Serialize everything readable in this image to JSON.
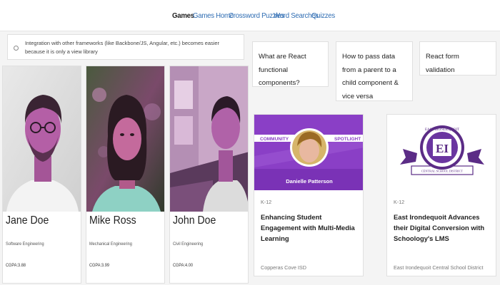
{
  "nav": {
    "items": [
      {
        "label": "Games",
        "active": true
      },
      {
        "label": "Games Home",
        "active": false
      },
      {
        "label": "Crossword Puzzles",
        "active": false
      },
      {
        "label": "Word Searches",
        "active": false
      },
      {
        "label": "Quizzes",
        "active": false
      }
    ]
  },
  "quiz_option": {
    "text": "Integration with other frameworks (like Backbone/JS, Angular, etc.) becomes easier because it is only a view library"
  },
  "question_cards": [
    {
      "text": "What are React functional components?"
    },
    {
      "text": "How to pass data from a parent to a child component & vice versa"
    },
    {
      "text": "React form validation"
    }
  ],
  "profiles": [
    {
      "name": "Jane Doe",
      "department": "Software Engineering",
      "gpa": "CGPA:3.88"
    },
    {
      "name": "Mike Ross",
      "department": "Mechanical Engineering",
      "gpa": "CGPA:3.99"
    },
    {
      "name": "John Doe",
      "department": "Civil Engineering",
      "gpa": "CGPA:4.00"
    }
  ],
  "articles": [
    {
      "banner_left": "COMMUNITY",
      "banner_right": "SPOTLIGHT",
      "banner_name": "Danielle Patterson",
      "tag": "K-12",
      "title": "Enhancing Student Engagement with Multi-Media Learning",
      "source": "Copperas Cove ISD"
    },
    {
      "logo_top": "EAST IRONDEQUOIT",
      "logo_letters": "EI",
      "logo_bottom": "CENTRAL SCHOOL DISTRICT",
      "tag": "K-12",
      "title": "East Irondequoit Advances their Digital Conversion with Schoology's LMS",
      "source": "East Irondequoit Central School District"
    }
  ],
  "colors": {
    "link": "#2f6db3",
    "accent_purple": "#8a3fc6",
    "card_border": "#e0e0e0",
    "background": "#f4f4f4"
  }
}
